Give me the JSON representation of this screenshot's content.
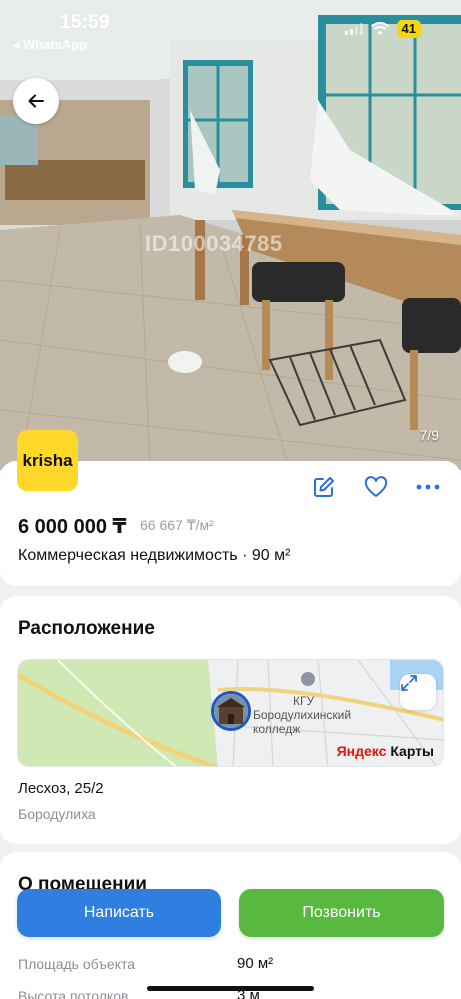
{
  "status_bar": {
    "time": "15:59",
    "back_app": "WhatsApp",
    "battery": "41"
  },
  "gallery": {
    "watermark": "ID100034785",
    "counter": "7/9"
  },
  "listing": {
    "logo_text": "krisha",
    "price": "6 000 000 ₸",
    "price_per_m2": "66 667 ₸/м²",
    "subtitle": "Коммерческая недвижимость · 90 м²"
  },
  "location": {
    "title": "Расположение",
    "map_brand_a": "Яндекс",
    "map_brand_b": "Карты",
    "map_label_kgu": "КГУ",
    "map_label_line1": "Бородулихинский",
    "map_label_line2": "колледж",
    "address": "Лесхоз, 25/2",
    "city": "Бородулиха"
  },
  "room": {
    "title": "О помещении",
    "rows": [
      {
        "label": "Площадь объекта",
        "value": "90 м²"
      },
      {
        "label": "Высота потолков",
        "value": "3 м"
      }
    ]
  },
  "buttons": {
    "write": "Написать",
    "call": "Позвонить"
  },
  "colors": {
    "primary_blue": "#2f7fe0",
    "call_green": "#58b83f",
    "krisha_yellow": "#ffd829",
    "accent_icon": "#2f6fd6"
  },
  "icons": {
    "back": "arrow-left-icon",
    "edit": "edit-icon",
    "favorite": "heart-icon",
    "more": "more-dots-icon",
    "expand": "expand-icon"
  }
}
